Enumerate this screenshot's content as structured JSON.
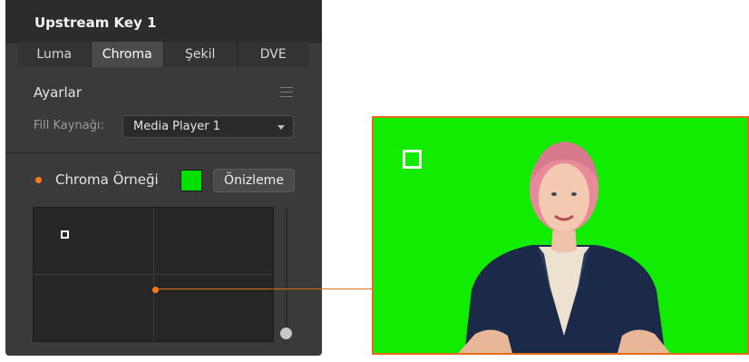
{
  "panel": {
    "title": "Upstream Key 1",
    "tabs": [
      {
        "label": "Luma",
        "active": false
      },
      {
        "label": "Chroma",
        "active": true
      },
      {
        "label": "Şekil",
        "active": false
      },
      {
        "label": "DVE",
        "active": false
      }
    ],
    "settings": {
      "title": "Ayarlar",
      "menu_icon": "hamburger-menu-icon",
      "fill_source_label": "Fill Kaynağı:",
      "fill_source_value": "Media Player 1"
    },
    "chroma_sample": {
      "label": "Chroma Örneği",
      "enabled": true,
      "swatch_color": "#00e000",
      "preview_button": "Önizleme"
    }
  },
  "colors": {
    "accent": "#e46a1a",
    "chroma_green": "#12ec00",
    "panel_bg": "#3a3a3a"
  }
}
